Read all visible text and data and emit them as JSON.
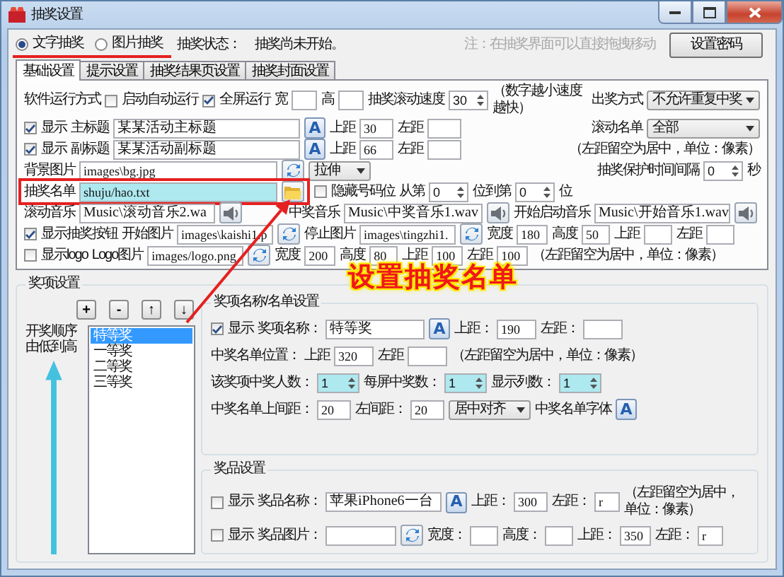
{
  "window": {
    "title": "抽奖设置"
  },
  "mode": {
    "options": [
      {
        "label": "文字抽奖",
        "selected": true
      },
      {
        "label": "图片抽奖",
        "selected": false
      }
    ],
    "status_label": "抽奖状态：",
    "status": "抽奖尚未开始。",
    "note": "注：在抽奖界面可以直接拖拽移动",
    "password_button": "设置密码"
  },
  "tabs": [
    {
      "label": "基础设置",
      "selected": true
    },
    {
      "label": "提示设置",
      "selected": false
    },
    {
      "label": "抽奖结果页设置",
      "selected": false
    },
    {
      "label": "抽奖封面设置",
      "selected": false
    }
  ],
  "basic_rows": [
    {
      "marked": false,
      "items": [
        {
          "kind": "label",
          "text": "软件运行方式"
        },
        {
          "kind": "check",
          "label": "启动自动运行",
          "checked": false
        },
        {
          "kind": "check",
          "label": "全屏运行",
          "checked": true
        },
        {
          "kind": "label",
          "text": "宽"
        },
        {
          "kind": "field",
          "highlighted": false
        },
        {
          "kind": "label",
          "text": "高"
        },
        {
          "kind": "field",
          "highlighted": false
        },
        {
          "kind": "label",
          "text": "抽奖滚动速度"
        },
        {
          "kind": "spin",
          "value": "30",
          "highlighted": false
        },
        {
          "kind": "note",
          "text": "（数字越小速度越快）"
        },
        {
          "kind": "label",
          "text": "出奖方式"
        },
        {
          "kind": "select",
          "value": "不允许重复中奖"
        }
      ]
    },
    {
      "marked": false,
      "items": [
        {
          "kind": "check",
          "label": "显示",
          "checked": true
        },
        {
          "kind": "label",
          "text": "主标题"
        },
        {
          "kind": "field",
          "value": "某某活动主标题",
          "highlighted": false
        },
        {
          "kind": "font",
          "glyph": "A"
        },
        {
          "kind": "label",
          "text": "上距"
        },
        {
          "kind": "field",
          "value": "30",
          "highlighted": false
        },
        {
          "kind": "label",
          "text": "左距"
        },
        {
          "kind": "field",
          "highlighted": false
        },
        {
          "kind": "label",
          "text": "滚动名单"
        },
        {
          "kind": "select",
          "value": "全部"
        }
      ]
    },
    {
      "marked": false,
      "items": [
        {
          "kind": "check",
          "label": "显示",
          "checked": true
        },
        {
          "kind": "label",
          "text": "副标题"
        },
        {
          "kind": "field",
          "value": "某某活动副标题",
          "highlighted": false
        },
        {
          "kind": "font",
          "glyph": "A"
        },
        {
          "kind": "label",
          "text": "上距"
        },
        {
          "kind": "field",
          "value": "66",
          "highlighted": false
        },
        {
          "kind": "label",
          "text": "左距"
        },
        {
          "kind": "field",
          "highlighted": false
        },
        {
          "kind": "note",
          "text": "（左距留空为居中，单位：像素）"
        }
      ]
    },
    {
      "marked": false,
      "items": [
        {
          "kind": "label",
          "text": "背景图片"
        },
        {
          "kind": "field",
          "value": "images\\bg.jpg",
          "highlighted": false
        },
        {
          "kind": "browse"
        },
        {
          "kind": "select",
          "value": "拉伸"
        },
        {
          "kind": "label",
          "text": "抽奖保护时间间隔"
        },
        {
          "kind": "spin",
          "value": "0",
          "highlighted": false
        },
        {
          "kind": "label",
          "text": "秒"
        }
      ]
    },
    {
      "marked": true,
      "items": [
        {
          "kind": "label",
          "text": "抽奖名单"
        },
        {
          "kind": "field",
          "value": "shuju/hao.txt",
          "highlighted": true
        },
        {
          "kind": "folder"
        },
        {
          "kind": "check",
          "label": "隐藏号码位",
          "checked": false
        },
        {
          "kind": "label",
          "text": "从第"
        },
        {
          "kind": "spin",
          "value": "0",
          "highlighted": false
        },
        {
          "kind": "label",
          "text": "位到第"
        },
        {
          "kind": "spin",
          "value": "0",
          "highlighted": false
        },
        {
          "kind": "label",
          "text": "位"
        }
      ]
    },
    {
      "marked": false,
      "items": [
        {
          "kind": "label",
          "text": "滚动音乐"
        },
        {
          "kind": "field",
          "value": "Music\\滚动音乐2.wa",
          "highlighted": false
        },
        {
          "kind": "sound"
        },
        {
          "kind": "label",
          "text": "中奖音乐"
        },
        {
          "kind": "field",
          "value": "Music\\中奖音乐1.wav",
          "highlighted": false
        },
        {
          "kind": "sound"
        },
        {
          "kind": "label",
          "text": "开始启动音乐"
        },
        {
          "kind": "field",
          "value": "Music\\开始音乐1.wav",
          "highlighted": false
        },
        {
          "kind": "sound"
        }
      ]
    },
    {
      "marked": false,
      "items": [
        {
          "kind": "check",
          "label": "显示抽奖按钮",
          "checked": true
        },
        {
          "kind": "label",
          "text": "开始图片"
        },
        {
          "kind": "field",
          "value": "images\\kaishi1.p",
          "highlighted": false
        },
        {
          "kind": "browse"
        },
        {
          "kind": "label",
          "text": "停止图片"
        },
        {
          "kind": "field",
          "value": "images\\tingzhi1.",
          "highlighted": false
        },
        {
          "kind": "browse"
        },
        {
          "kind": "label",
          "text": "宽度"
        },
        {
          "kind": "field",
          "value": "180",
          "highlighted": false
        },
        {
          "kind": "label",
          "text": "高度"
        },
        {
          "kind": "field",
          "value": "50",
          "highlighted": false
        },
        {
          "kind": "label",
          "text": "上距"
        },
        {
          "kind": "field",
          "highlighted": false
        },
        {
          "kind": "label",
          "text": "左距"
        },
        {
          "kind": "field",
          "highlighted": false
        }
      ]
    },
    {
      "marked": false,
      "items": [
        {
          "kind": "check",
          "label": "显示logo",
          "checked": false
        },
        {
          "kind": "label",
          "text": "Logo图片"
        },
        {
          "kind": "field",
          "value": "images/logo.png",
          "highlighted": false
        },
        {
          "kind": "browse"
        },
        {
          "kind": "label",
          "text": "宽度"
        },
        {
          "kind": "field",
          "value": "200",
          "highlighted": false
        },
        {
          "kind": "label",
          "text": "高度"
        },
        {
          "kind": "field",
          "value": "80",
          "highlighted": false
        },
        {
          "kind": "label",
          "text": "上距"
        },
        {
          "kind": "field",
          "value": "100",
          "highlighted": false
        },
        {
          "kind": "label",
          "text": "左距"
        },
        {
          "kind": "field",
          "value": "100",
          "highlighted": false
        },
        {
          "kind": "note",
          "text": "（左距留空为居中，单位：像素）"
        }
      ]
    }
  ],
  "prizes": {
    "title": "奖项设置",
    "buttons": [
      "+",
      "-",
      "↑",
      "↓"
    ],
    "order_label": "开奖顺序由低到高",
    "list": [
      {
        "label": "特等奖",
        "selected": true
      },
      {
        "label": "一等奖",
        "selected": false
      },
      {
        "label": "二等奖",
        "selected": false
      },
      {
        "label": "三等奖",
        "selected": false
      }
    ],
    "name_group": {
      "title": "奖项名称/名单设置",
      "rows": [
        {
          "items": [
            {
              "kind": "check",
              "label": "显示",
              "checked": true
            },
            {
              "kind": "label",
              "text": "奖项名称："
            },
            {
              "kind": "field",
              "value": "特等奖",
              "highlighted": false
            },
            {
              "kind": "font",
              "glyph": "A"
            },
            {
              "kind": "label",
              "text": "上距："
            },
            {
              "kind": "field",
              "value": "190",
              "highlighted": false
            },
            {
              "kind": "label",
              "text": "左距："
            },
            {
              "kind": "field",
              "highlighted": false
            }
          ]
        },
        {
          "items": [
            {
              "kind": "label",
              "text": "中奖名单位置："
            },
            {
              "kind": "label",
              "text": "上距"
            },
            {
              "kind": "field",
              "value": "320",
              "highlighted": false
            },
            {
              "kind": "label",
              "text": "左距"
            },
            {
              "kind": "field",
              "highlighted": false
            },
            {
              "kind": "note",
              "text": "（左距留空为居中，单位：像素）"
            }
          ]
        },
        {
          "items": [
            {
              "kind": "label",
              "text": "该奖项中奖人数："
            },
            {
              "kind": "spin",
              "value": "1",
              "highlighted": true
            },
            {
              "kind": "label",
              "text": "每屏中奖数："
            },
            {
              "kind": "spin",
              "value": "1",
              "highlighted": true
            },
            {
              "kind": "label",
              "text": "显示列数："
            },
            {
              "kind": "spin",
              "value": "1",
              "highlighted": true
            }
          ]
        },
        {
          "items": [
            {
              "kind": "label",
              "text": "中奖名单上间距："
            },
            {
              "kind": "field",
              "value": "20",
              "highlighted": false
            },
            {
              "kind": "label",
              "text": "左间距："
            },
            {
              "kind": "field",
              "value": "20",
              "highlighted": false
            },
            {
              "kind": "select",
              "value": "居中对齐"
            },
            {
              "kind": "label",
              "text": "中奖名单字体"
            },
            {
              "kind": "font",
              "glyph": "A"
            }
          ]
        }
      ]
    },
    "goods_group": {
      "title": "奖品设置",
      "rows": [
        {
          "items": [
            {
              "kind": "check",
              "label": "显示",
              "checked": false
            },
            {
              "kind": "label",
              "text": "奖品名称："
            },
            {
              "kind": "field",
              "value": "苹果iPhone6一台",
              "highlighted": false
            },
            {
              "kind": "font",
              "glyph": "A"
            },
            {
              "kind": "label",
              "text": "上距："
            },
            {
              "kind": "field",
              "value": "300",
              "highlighted": false
            },
            {
              "kind": "label",
              "text": "左距："
            },
            {
              "kind": "field",
              "value": "r",
              "highlighted": false
            },
            {
              "kind": "note",
              "text": "（左距留空为居中，单位：像素）"
            }
          ]
        },
        {
          "items": [
            {
              "kind": "check",
              "label": "显示",
              "checked": false
            },
            {
              "kind": "label",
              "text": "奖品图片："
            },
            {
              "kind": "field",
              "highlighted": false
            },
            {
              "kind": "browse"
            },
            {
              "kind": "label",
              "text": "宽度："
            },
            {
              "kind": "field",
              "highlighted": false
            },
            {
              "kind": "label",
              "text": "高度："
            },
            {
              "kind": "field",
              "highlighted": false
            },
            {
              "kind": "label",
              "text": "上距："
            },
            {
              "kind": "field",
              "value": "350",
              "highlighted": false
            },
            {
              "kind": "label",
              "text": "左距："
            },
            {
              "kind": "field",
              "value": "r",
              "highlighted": false
            }
          ]
        }
      ]
    }
  },
  "annotation": {
    "text": "设置抽奖名单"
  }
}
